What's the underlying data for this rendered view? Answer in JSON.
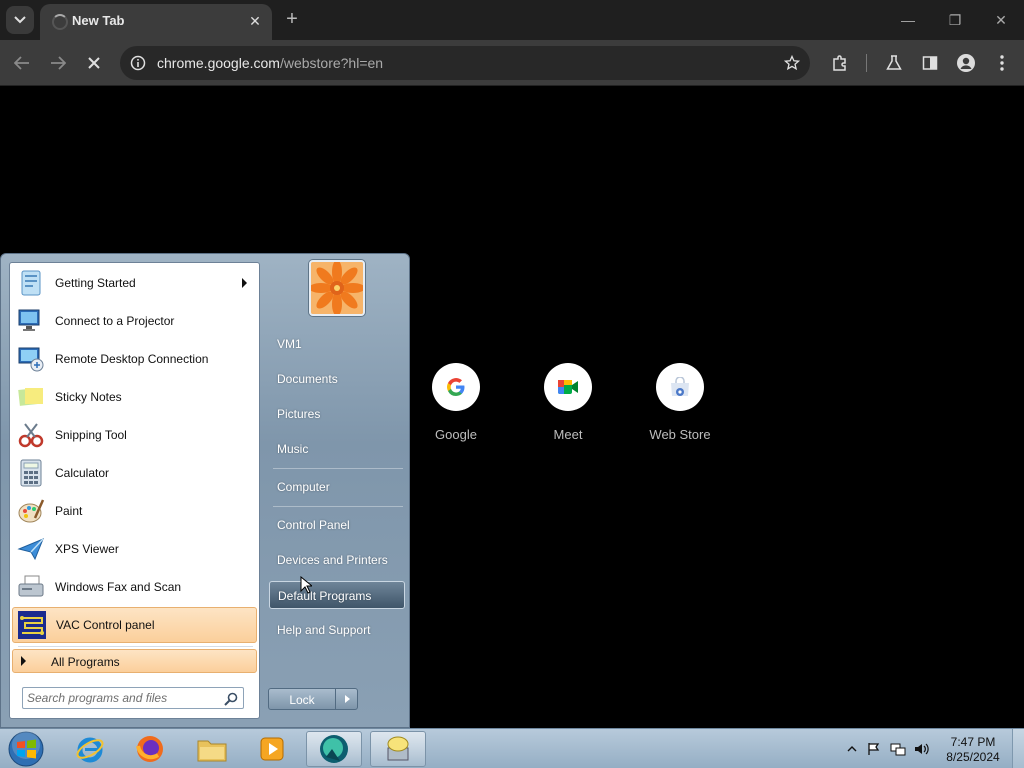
{
  "browser": {
    "tab_title": "New Tab",
    "url_host": "chrome.google.com",
    "url_path": "/webstore?hl=en",
    "icons": [
      "tab-search-icon",
      "close-icon",
      "new-tab-icon",
      "back-icon",
      "forward-icon",
      "stop-icon",
      "site-info-icon",
      "star-icon",
      "extensions-icon",
      "labs-icon",
      "side-panel-icon",
      "profile-icon",
      "menu-icon"
    ]
  },
  "shortcuts": [
    {
      "label": "Google"
    },
    {
      "label": "Meet"
    },
    {
      "label": "Web Store"
    }
  ],
  "start_menu": {
    "programs": [
      {
        "label": "Getting Started",
        "icon": "getting-started-icon",
        "has_submenu": true
      },
      {
        "label": "Connect to a Projector",
        "icon": "projector-icon"
      },
      {
        "label": "Remote Desktop Connection",
        "icon": "remote-desktop-icon"
      },
      {
        "label": "Sticky Notes",
        "icon": "sticky-notes-icon"
      },
      {
        "label": "Snipping Tool",
        "icon": "snipping-tool-icon"
      },
      {
        "label": "Calculator",
        "icon": "calculator-icon"
      },
      {
        "label": "Paint",
        "icon": "paint-icon"
      },
      {
        "label": "XPS Viewer",
        "icon": "xps-viewer-icon"
      },
      {
        "label": "Windows Fax and Scan",
        "icon": "fax-scan-icon"
      },
      {
        "label": "VAC Control panel",
        "icon": "vac-icon",
        "highlighted": true
      }
    ],
    "all_programs": "All Programs",
    "search_placeholder": "Search programs and files",
    "right_items": [
      {
        "label": "VM1"
      },
      {
        "label": "Documents"
      },
      {
        "label": "Pictures"
      },
      {
        "label": "Music"
      },
      {
        "label": "Computer"
      },
      {
        "label": "Control Panel"
      },
      {
        "label": "Devices and Printers"
      },
      {
        "label": "Default Programs",
        "highlighted": true
      },
      {
        "label": "Help and Support"
      }
    ],
    "lock_label": "Lock"
  },
  "taskbar": {
    "apps": [
      "internet-explorer-icon",
      "firefox-icon",
      "file-explorer-icon",
      "media-player-icon",
      "app-active-icon",
      "network-app-icon"
    ],
    "time": "7:47 PM",
    "date": "8/25/2024"
  },
  "colors": {
    "chrome_dark": "#3c3c3c",
    "start_menu_blue": "#8aa0b4",
    "highlight_orange": "#fbcf9b"
  }
}
